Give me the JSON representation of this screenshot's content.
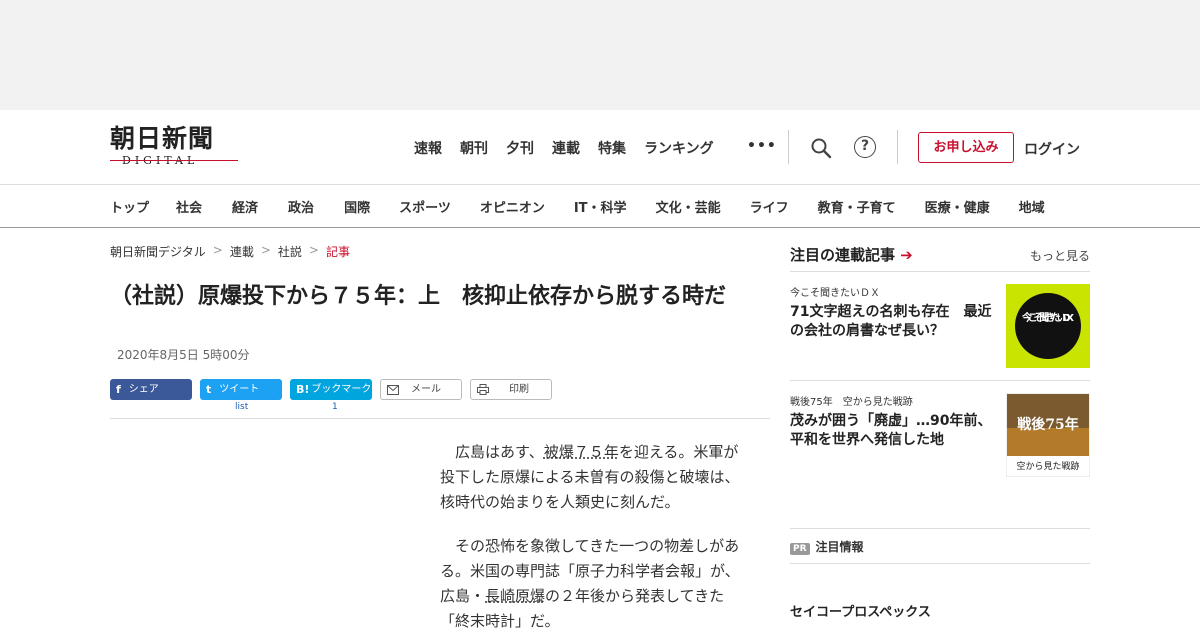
{
  "site": {
    "logo_main": "朝日新聞",
    "logo_sub": "DIGITAL"
  },
  "topnav": {
    "items": [
      "速報",
      "朝刊",
      "夕刊",
      "連載",
      "特集",
      "ランキング"
    ],
    "more": "•••"
  },
  "header": {
    "subscribe": "お申し込み",
    "login": "ログイン",
    "help": "?"
  },
  "catnav": {
    "items": [
      "トップ",
      "社会",
      "経済",
      "政治",
      "国際",
      "スポーツ",
      "オピニオン",
      "IT・科学",
      "文化・芸能",
      "ライフ",
      "教育・子育て",
      "医療・健康",
      "地域"
    ]
  },
  "breadcrumb": {
    "items": [
      "朝日新聞デジタル",
      "連載",
      "社説"
    ],
    "current": "記事",
    "sep": ">"
  },
  "article": {
    "title": "（社説）原爆投下から７５年：上　核抑止依存から脱する時だ",
    "date": "2020年8月5日 5時00分",
    "p1_a": "広島はあす、",
    "p1_link": "被爆７５年",
    "p1_b": "を迎える。米軍が投下した原爆による未曽有の殺傷と破壊は、核時代の始まりを人類史に刻んだ。",
    "p2_a": "その恐怖を象徴してきた一つの物差しがある。米国の専門誌「原子力科学者会報」が、広島・",
    "p2_link": "長崎原爆",
    "p2_b": "の２年後から発表してきた「終末時計」だ。"
  },
  "share": {
    "facebook": "シェア",
    "twitter": "ツイート",
    "hatena": "ブックマーク",
    "mail": "メール",
    "print": "印刷",
    "twitter_count": "list",
    "hatena_count": "1",
    "facebook_icon": "f",
    "twitter_icon": "t",
    "hatena_icon": "B!"
  },
  "sidebar": {
    "title": "注目の連載記事",
    "more": "もっと見る",
    "items": [
      {
        "kicker": "今こそ聞きたいＤＸ",
        "headline": "71文字超えの名刺も存在　最近の会社の肩書なぜ長い？",
        "thumb_text": "今こそ聞きたいDX"
      },
      {
        "kicker": "戦後75年　空から見た戦跡",
        "headline": "茂みが囲う「廃虚」…90年前、平和を世界へ発信した地",
        "thumb_text_top": "戦後75年",
        "thumb_text_bottom": "空から見た戦跡"
      }
    ],
    "pr_badge": "PR",
    "pr_title": "注目情報",
    "pr_company": "セイコープロスペックス"
  },
  "colors": {
    "brand_red": "#c8102e",
    "facebook": "#3b5998",
    "twitter": "#1da1f2",
    "hatena": "#00a4de"
  }
}
